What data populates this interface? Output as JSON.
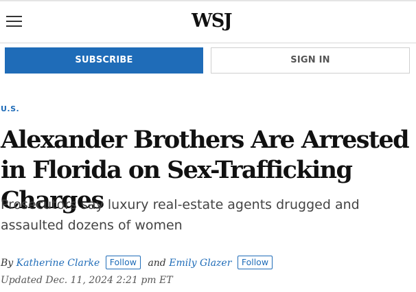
{
  "header": {
    "logo_text": "WSJ",
    "menu_icon": "hamburger-menu-icon"
  },
  "actions": {
    "subscribe_label": "SUBSCRIBE",
    "signin_label": "SIGN IN"
  },
  "article": {
    "section": "U.S.",
    "headline": "Alexander Brothers Are Arrested in Florida on Sex-Trafficking Charges",
    "dek": "Prosecutors say luxury real-estate agents drugged and assaulted dozens of women",
    "byline": {
      "prefix": "By",
      "authors": [
        {
          "name": "Katherine Clarke",
          "follow_label": "Follow"
        },
        {
          "name": "Emily Glazer",
          "follow_label": "Follow"
        }
      ],
      "joiner": "and"
    },
    "updated": "Updated Dec. 11, 2024 2:21 pm ET"
  },
  "colors": {
    "accent": "#1f6cb8",
    "text": "#111111",
    "dek_text": "#444444",
    "border": "#d9d9d9"
  }
}
